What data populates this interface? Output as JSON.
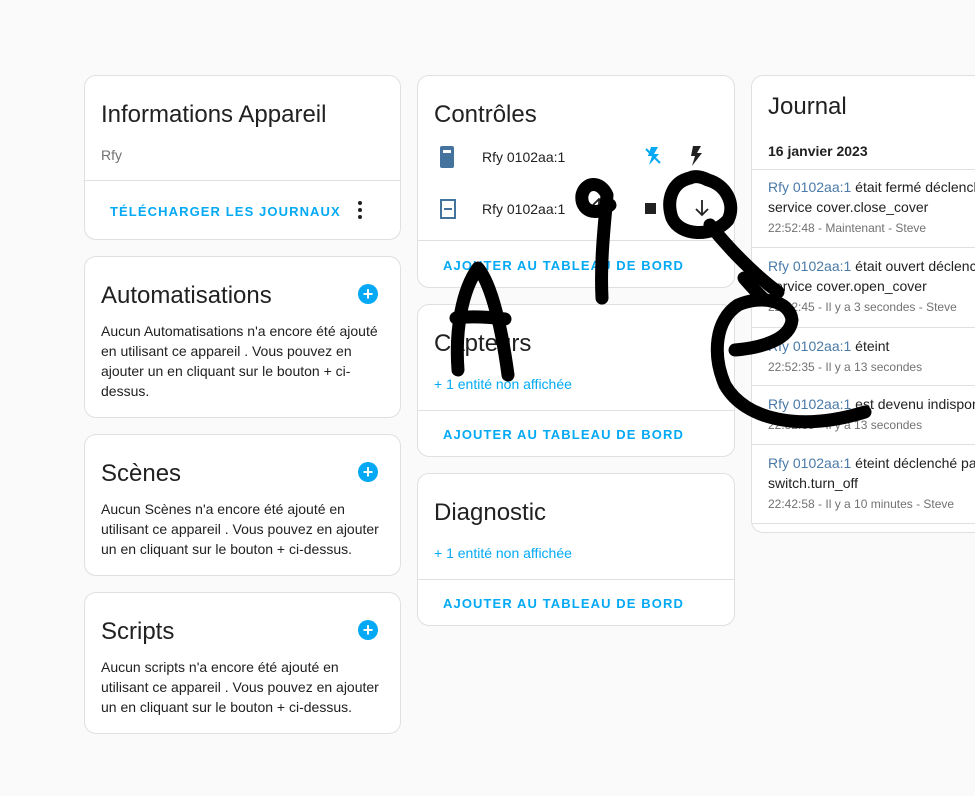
{
  "device_info": {
    "title": "Informations Appareil",
    "subtitle": "Rfy",
    "download_label": "TÉLÉCHARGER LES JOURNAUX"
  },
  "automations": {
    "title": "Automatisations",
    "text": "Aucun Automatisations n'a encore été ajouté en utilisant ce appareil . Vous pouvez en ajouter un en cliquant sur le bouton + ci-dessus."
  },
  "scenes": {
    "title": "Scènes",
    "text": "Aucun Scènes n'a encore été ajouté en utilisant ce appareil . Vous pouvez en ajouter un en cliquant sur le bouton + ci-dessus."
  },
  "scripts": {
    "title": "Scripts",
    "text": "Aucun scripts n'a encore été ajouté en utilisant ce appareil . Vous pouvez en ajouter un en cliquant sur le bouton + ci-dessus."
  },
  "controls": {
    "title": "Contrôles",
    "entities": [
      {
        "name": "Rfy 0102aa:1",
        "icon": "remote-icon"
      },
      {
        "name": "Rfy 0102aa:1",
        "icon": "window-shutter-icon"
      }
    ],
    "add_label": "AJOUTER AU TABLEAU DE BORD"
  },
  "sensors": {
    "title": "Capteurs",
    "hidden_label": "+ 1 entité non affichée",
    "add_label": "AJOUTER AU TABLEAU DE BORD"
  },
  "diagnostic": {
    "title": "Diagnostic",
    "hidden_label": "+ 1 entité non affichée",
    "add_label": "AJOUTER AU TABLEAU DE BORD"
  },
  "journal": {
    "title": "Journal",
    "date": "16 janvier 2023",
    "entries": [
      {
        "entity": "Rfy 0102aa:1",
        "text": " était fermé déclenché par le",
        "text2": "service cover.close_cover",
        "meta": "22:52:48 - Maintenant - Steve"
      },
      {
        "entity": "Rfy 0102aa:1",
        "text": " était ouvert déclenché par le",
        "text2": "service cover.open_cover",
        "meta": "22:52:45 - Il y a 3 secondes - Steve"
      },
      {
        "entity": "Rfy 0102aa:1",
        "text": " éteint",
        "text2": "",
        "meta": "22:52:35 - Il y a 13 secondes"
      },
      {
        "entity": "Rfy 0102aa:1",
        "text": " est devenu indisponible",
        "text2": "",
        "meta": "22:52:35 - Il y a 13 secondes"
      },
      {
        "entity": "Rfy 0102aa:1",
        "text": " éteint déclenché par le service",
        "text2": "switch.turn_off",
        "meta": "22:42:58 - Il y a 10 minutes - Steve"
      }
    ]
  }
}
